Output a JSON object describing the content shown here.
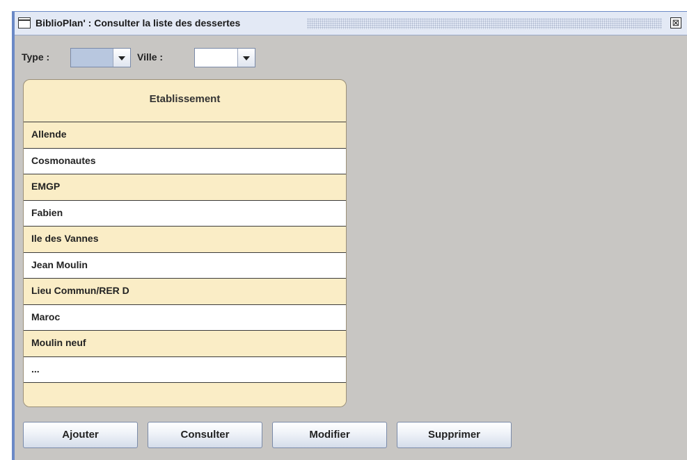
{
  "window": {
    "title": "BiblioPlan' : Consulter la liste des dessertes",
    "close_glyph": "⊠"
  },
  "filters": {
    "type_label": "Type :",
    "type_value": "",
    "ville_label": "Ville :",
    "ville_value": ""
  },
  "table": {
    "header": "Etablissement",
    "rows": [
      "Allende",
      "Cosmonautes",
      "EMGP",
      "Fabien",
      "Ile des Vannes",
      "Jean Moulin",
      "Lieu Commun/RER D",
      "Maroc",
      "Moulin neuf",
      "...",
      ""
    ]
  },
  "buttons": {
    "add": "Ajouter",
    "view": "Consulter",
    "edit": "Modifier",
    "delete": "Supprimer"
  },
  "colors": {
    "row_highlight": "#faedc6",
    "row_plain": "#ffffff",
    "window_bg": "#c8c6c3",
    "frame": "#6b89c6"
  },
  "icons": {
    "title": "window-icon",
    "close": "close-icon",
    "dropdown": "chevron-down-icon"
  }
}
